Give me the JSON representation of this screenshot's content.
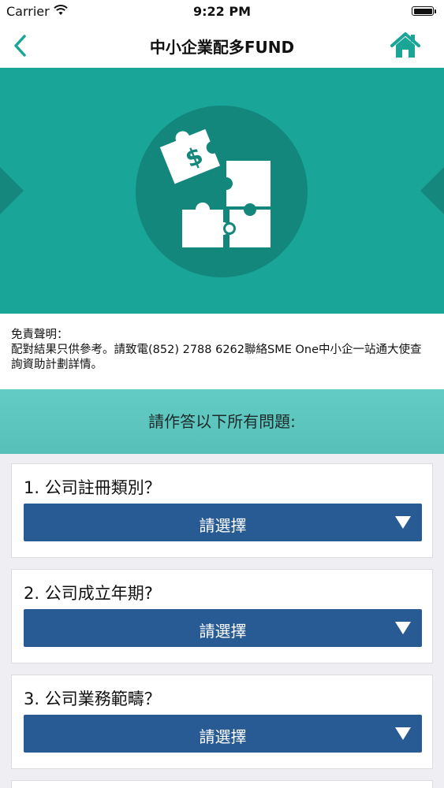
{
  "status_bar": {
    "carrier": "Carrier",
    "time": "9:22 PM"
  },
  "nav": {
    "title": "中小企業配多FUND",
    "back_icon": "chevron-left-icon",
    "home_icon": "home-icon"
  },
  "banner": {
    "icon": "puzzle-icon",
    "background_color": "#19a597"
  },
  "disclaimer": {
    "title": "免責聲明：",
    "text": "配對結果只供參考。請致電(852) 2788 6262聯絡SME One中小企一站通大使查詢資助計劃詳情。"
  },
  "question_header": "請作答以下所有問題:",
  "questions": [
    {
      "label": "1. 公司註冊類別？",
      "select_value": "請選擇"
    },
    {
      "label": "2. 公司成立年期?",
      "select_value": "請選擇"
    },
    {
      "label": "3. 公司業務範疇？",
      "select_value": "請選擇"
    }
  ],
  "colors": {
    "accent_teal": "#1aa597",
    "select_blue": "#285b94",
    "header_teal": "#5fc6bf"
  }
}
